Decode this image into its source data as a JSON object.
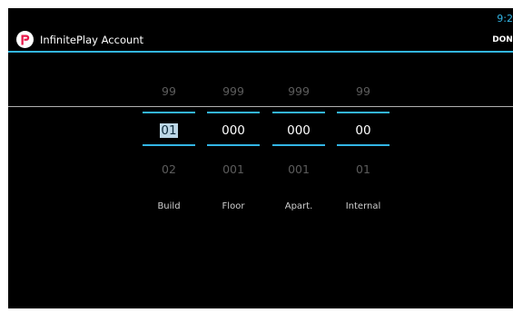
{
  "status_bar": {
    "time": "9:2"
  },
  "action_bar": {
    "title": "InfinitePlay Account",
    "done_label": "DONE",
    "accent_color": "#33b5e5",
    "logo_color": "#e8194a",
    "logo_icon": "infiniteplay-logo-icon"
  },
  "picker": {
    "columns": [
      {
        "label": "Build",
        "prev": "99",
        "current": "01",
        "next": "02",
        "focused": true
      },
      {
        "label": "Floor",
        "prev": "999",
        "current": "000",
        "next": "001",
        "focused": false
      },
      {
        "label": "Apart.",
        "prev": "999",
        "current": "000",
        "next": "001",
        "focused": false
      },
      {
        "label": "Internal",
        "prev": "99",
        "current": "00",
        "next": "01",
        "focused": false
      }
    ]
  }
}
